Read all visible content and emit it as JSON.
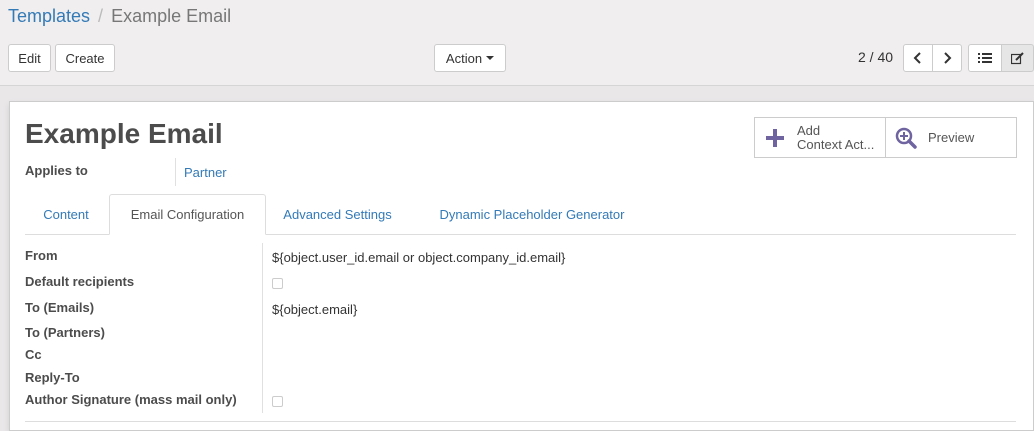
{
  "breadcrumb": {
    "parent": "Templates",
    "separator": "/",
    "current": "Example Email"
  },
  "toolbar": {
    "edit_label": "Edit",
    "create_label": "Create",
    "action_label": "Action"
  },
  "pager": {
    "value": "2 / 40"
  },
  "record": {
    "title": "Example Email",
    "applies_to_label": "Applies to",
    "applies_to_value": "Partner"
  },
  "stat_buttons": {
    "context_line1": "Add",
    "context_line2": "Context Act...",
    "preview_label": "Preview"
  },
  "tabs": [
    {
      "label": "Content"
    },
    {
      "label": "Email Configuration"
    },
    {
      "label": "Advanced Settings"
    },
    {
      "label": "Dynamic Placeholder Generator"
    }
  ],
  "fields": {
    "from_label": "From",
    "from_value": "${object.user_id.email or object.company_id.email}",
    "default_recipients_label": "Default recipients",
    "to_emails_label": "To (Emails)",
    "to_emails_value": "${object.email}",
    "to_partners_label": "To (Partners)",
    "cc_label": "Cc",
    "reply_to_label": "Reply-To",
    "author_signature_label": "Author Signature (mass mail only)"
  },
  "colors": {
    "link": "#337ab7",
    "icon_purple": "#6f63a0"
  },
  "icons": [
    "chevron-left-icon",
    "chevron-right-icon",
    "list-icon",
    "edit-icon",
    "plus-icon",
    "zoom-in-icon"
  ]
}
